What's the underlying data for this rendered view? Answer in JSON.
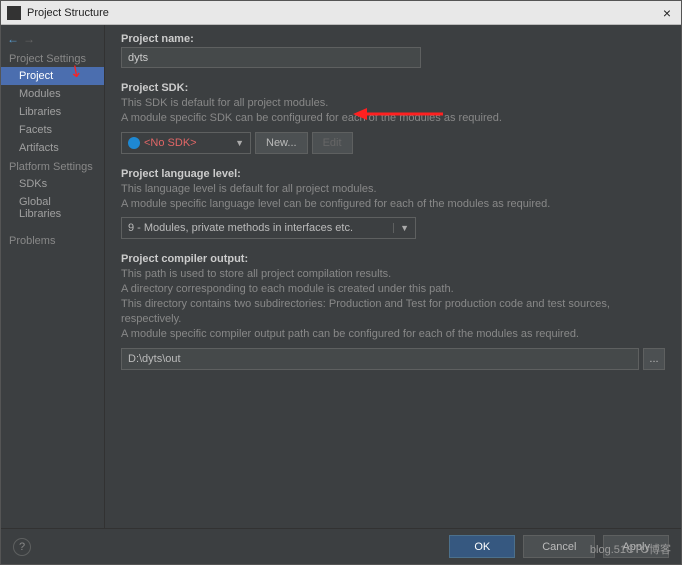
{
  "window": {
    "title": "Project Structure",
    "close": "×"
  },
  "sidebar": {
    "section1": "Project Settings",
    "items1": [
      "Project",
      "Modules",
      "Libraries",
      "Facets",
      "Artifacts"
    ],
    "section2": "Platform Settings",
    "items2": [
      "SDKs",
      "Global Libraries"
    ],
    "section3": "Problems"
  },
  "main": {
    "projectName": {
      "label": "Project name:",
      "value": "dyts"
    },
    "sdk": {
      "label": "Project SDK:",
      "desc1": "This SDK is default for all project modules.",
      "desc2": "A module specific SDK can be configured for each of the modules as required.",
      "value": "<No SDK>",
      "newBtn": "New...",
      "editBtn": "Edit"
    },
    "lang": {
      "label": "Project language level:",
      "desc1": "This language level is default for all project modules.",
      "desc2": "A module specific language level can be configured for each of the modules as required.",
      "value": "9 - Modules, private methods in interfaces etc."
    },
    "output": {
      "label": "Project compiler output:",
      "desc1": "This path is used to store all project compilation results.",
      "desc2": "A directory corresponding to each module is created under this path.",
      "desc3": "This directory contains two subdirectories: Production and Test for production code and test sources, respectively.",
      "desc4": "A module specific compiler output path can be configured for each of the modules as required.",
      "value": "D:\\dyts\\out",
      "browse": "..."
    }
  },
  "footer": {
    "help": "?",
    "ok": "OK",
    "cancel": "Cancel",
    "apply": "Apply"
  },
  "watermark": "blog.51CTO博客"
}
